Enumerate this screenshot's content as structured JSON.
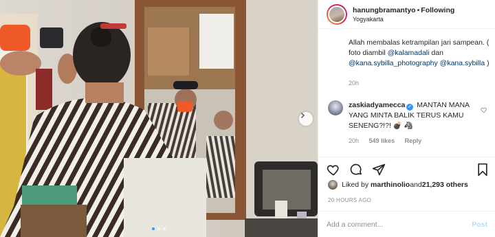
{
  "post": {
    "username": "hanungbramantyo",
    "separator": "•",
    "follow_status": "Following",
    "location": "Yogyakarta",
    "caption": {
      "text_1": "Allah membalas ketrampilan jari sampean. ( foto diambil ",
      "mention_1": "@kalamadali",
      "text_2": " dan ",
      "mention_2": "@kana.sybilla_photography",
      "text_3": " ",
      "mention_3": "@kana.sybilla",
      "text_4": " )",
      "time": "20h"
    },
    "comment": {
      "username": "zaskiadyamecca",
      "verified_mark": "✓",
      "text": "MANTAN MANA YANG MINTA BALIK TERUS KAMU SENENG?!?! 💣 🦓",
      "time": "20h",
      "likes": "549 likes",
      "reply_label": "Reply"
    },
    "likes": {
      "prefix": "Liked by ",
      "user": "marthinolio",
      "middle": " and ",
      "count": "21,293 others"
    },
    "posted_ago": "20 HOURS AGO",
    "add_comment": {
      "placeholder": "Add a comment...",
      "post_label": "Post"
    },
    "carousel": {
      "slide_count": 3,
      "active_index": 0
    }
  },
  "icons": {
    "heart": "heart-icon",
    "comment": "comment-icon",
    "share": "share-icon",
    "save": "bookmark-icon",
    "next": "chevron-right-icon"
  },
  "colors": {
    "link": "#00376b",
    "muted": "#8e8e8e",
    "verified": "#3897f0",
    "post_disabled": "#b2dffc"
  }
}
